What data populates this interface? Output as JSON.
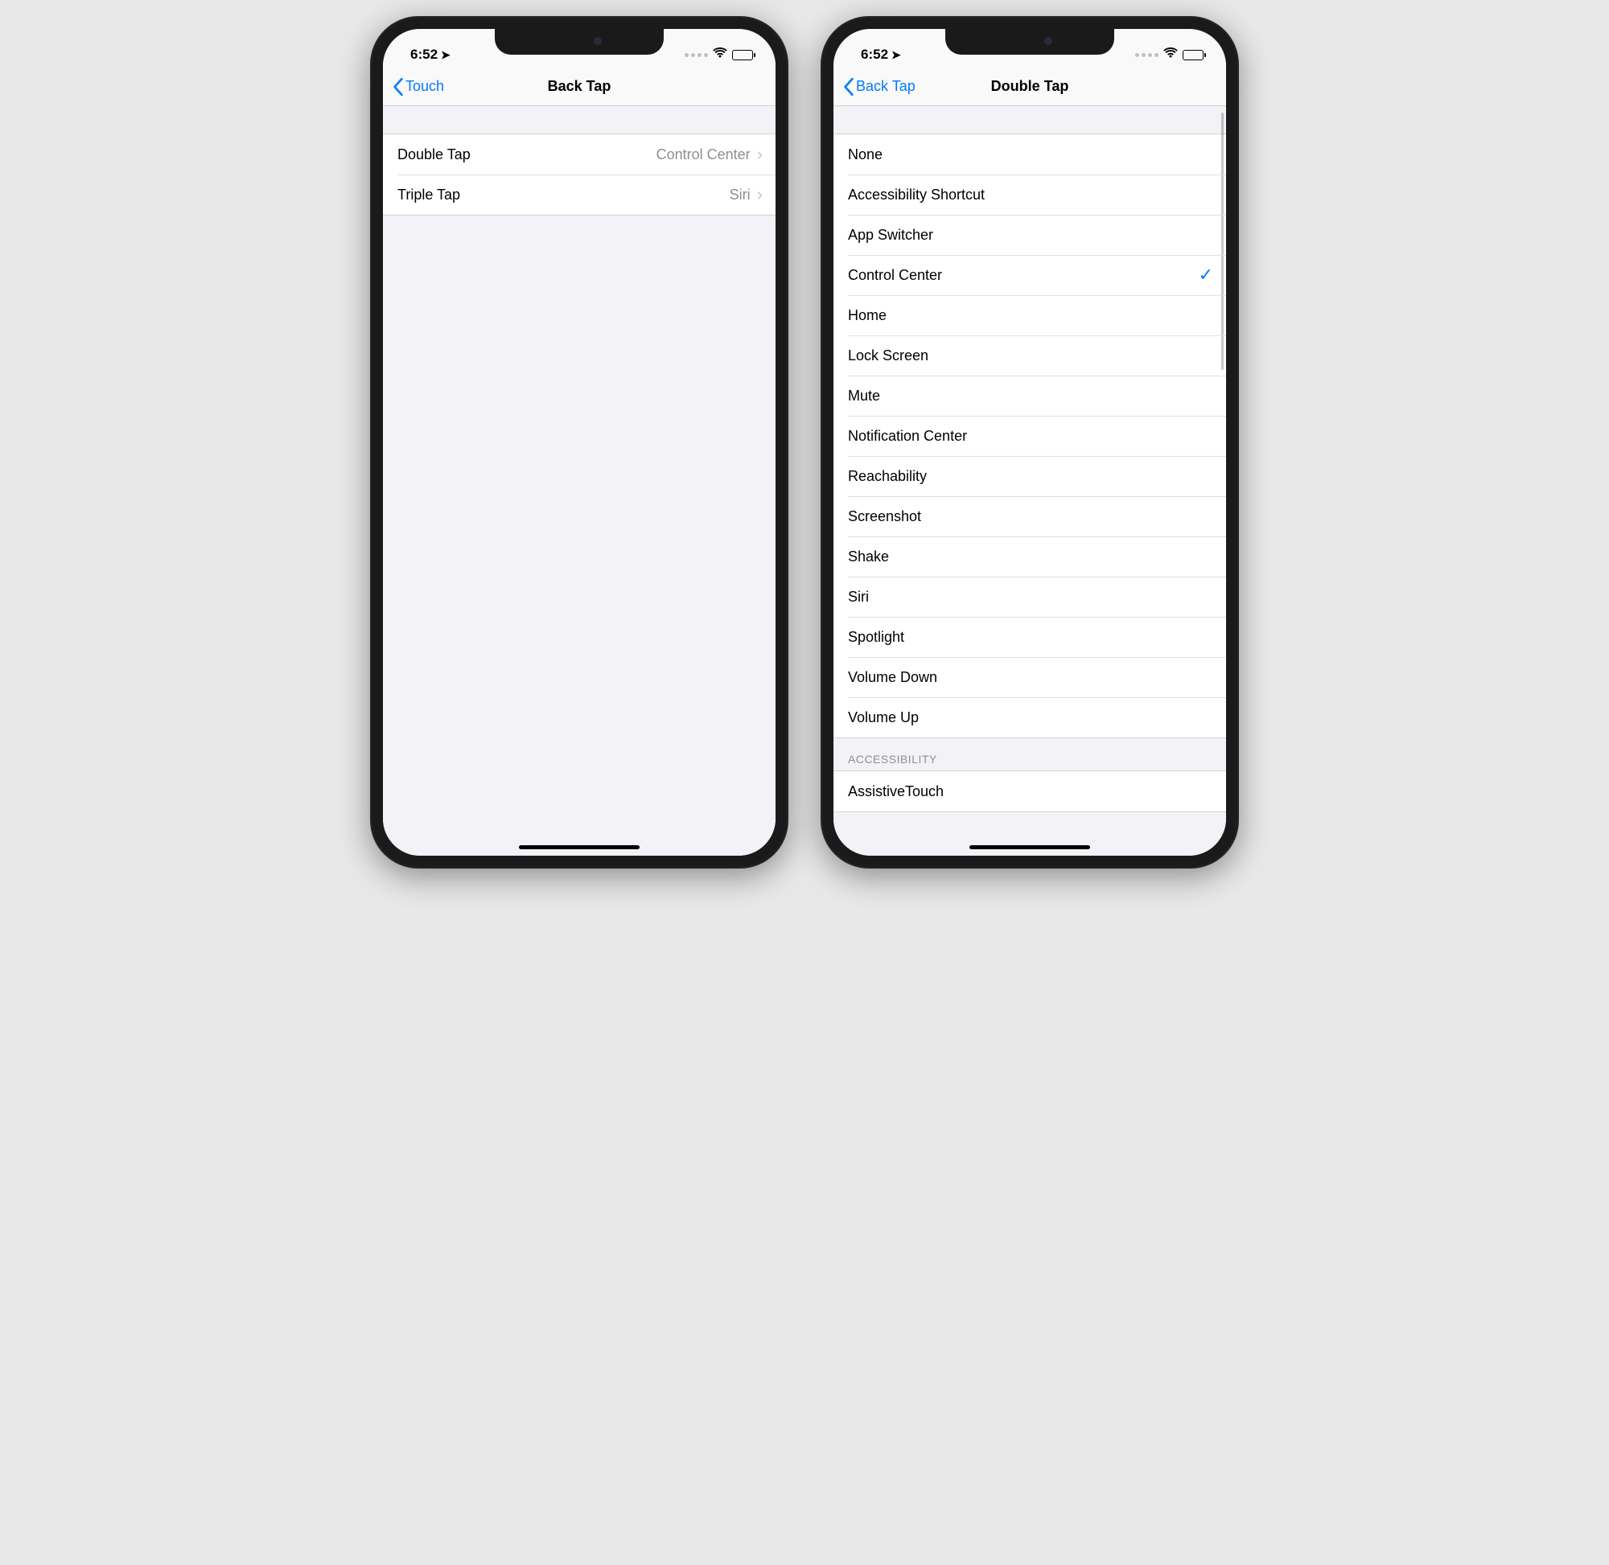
{
  "left": {
    "status": {
      "time": "6:52"
    },
    "nav": {
      "back": "Touch",
      "title": "Back Tap"
    },
    "rows": [
      {
        "label": "Double Tap",
        "value": "Control Center"
      },
      {
        "label": "Triple Tap",
        "value": "Siri"
      }
    ]
  },
  "right": {
    "status": {
      "time": "6:52"
    },
    "nav": {
      "back": "Back Tap",
      "title": "Double Tap"
    },
    "selected": "Control Center",
    "options": [
      "None",
      "Accessibility Shortcut",
      "App Switcher",
      "Control Center",
      "Home",
      "Lock Screen",
      "Mute",
      "Notification Center",
      "Reachability",
      "Screenshot",
      "Shake",
      "Siri",
      "Spotlight",
      "Volume Down",
      "Volume Up"
    ],
    "section2": {
      "header": "ACCESSIBILITY",
      "first": "AssistiveTouch"
    }
  }
}
